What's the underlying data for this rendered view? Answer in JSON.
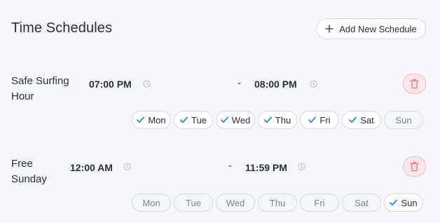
{
  "header": {
    "title": "Time Schedules",
    "add_button_label": "Add New Schedule"
  },
  "schedules": [
    {
      "name": "Safe Surfing Hour",
      "start": "07:00 PM",
      "separator": "-",
      "end": "08:00 PM",
      "days": [
        {
          "label": "Mon",
          "checked": true
        },
        {
          "label": "Tue",
          "checked": true
        },
        {
          "label": "Wed",
          "checked": true
        },
        {
          "label": "Thu",
          "checked": true
        },
        {
          "label": "Fri",
          "checked": true
        },
        {
          "label": "Sat",
          "checked": true
        },
        {
          "label": "Sun",
          "checked": false
        }
      ]
    },
    {
      "name": "Free Sunday",
      "start": "12:00 AM",
      "separator": "-",
      "end": "11:59 PM",
      "days": [
        {
          "label": "Mon",
          "checked": false
        },
        {
          "label": "Tue",
          "checked": false
        },
        {
          "label": "Wed",
          "checked": false
        },
        {
          "label": "Thu",
          "checked": false
        },
        {
          "label": "Fri",
          "checked": false
        },
        {
          "label": "Sat",
          "checked": false
        },
        {
          "label": "Sun",
          "checked": true
        }
      ]
    }
  ],
  "colors": {
    "check": "#1a8fd1",
    "delete_icon": "#ef6b78",
    "delete_bg": "#fde6e8",
    "clock_icon": "#b7bcc3"
  },
  "icons": {
    "add": "plus-icon",
    "time": "clock-icon",
    "delete": "trash-icon",
    "day_selected": "check-icon"
  }
}
